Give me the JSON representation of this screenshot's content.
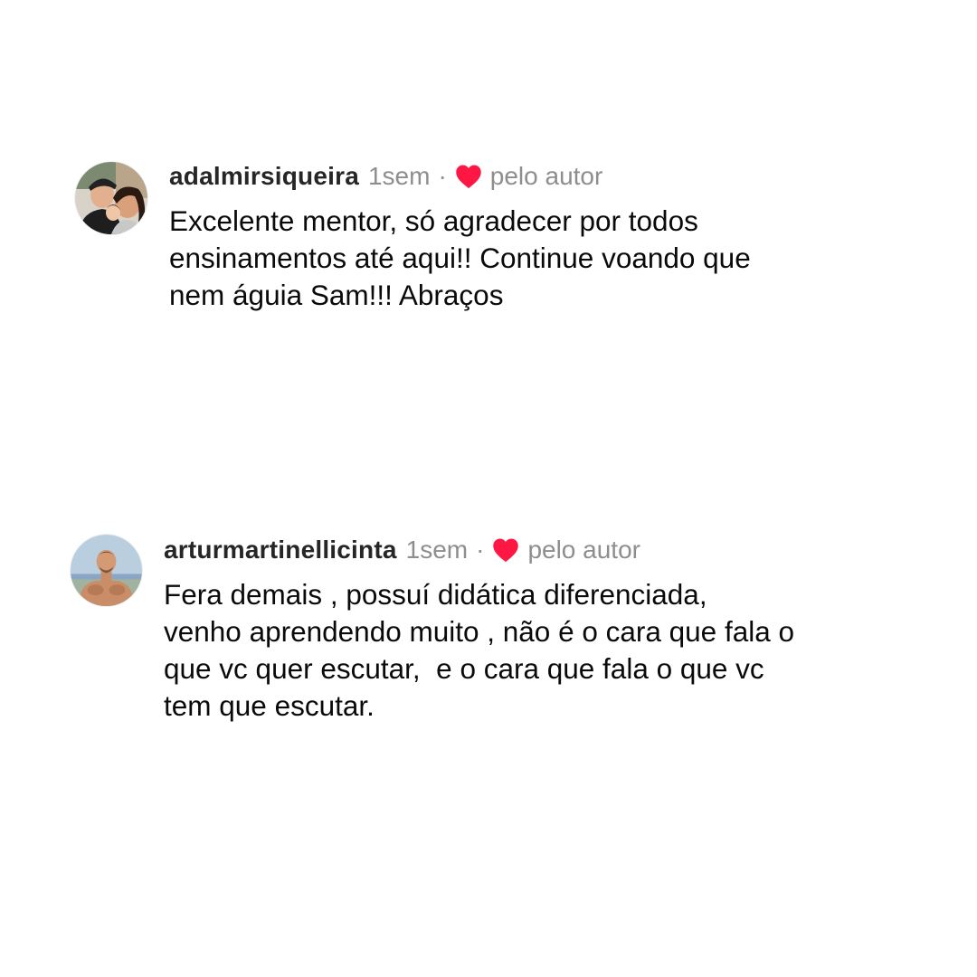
{
  "comments": [
    {
      "username": "adalmirsiqueira",
      "time": "1sem",
      "separator": "·",
      "liked_label": "pelo autor",
      "text": "Excelente mentor, só agradecer por todos\nensinamentos até aqui!! Continue voando que\nnem águia Sam!!! Abraços"
    },
    {
      "username": "arturmartinellicinta",
      "time": "1sem",
      "separator": "·",
      "liked_label": "pelo autor",
      "text": "Fera demais , possuí didática diferenciada,\nvenho aprendendo muito , não é o cara que fala o\nque vc quer escutar,  e o cara que fala o que vc\ntem que escutar."
    }
  ],
  "colors": {
    "heart": "#ff1744",
    "username": "#262626",
    "secondary_text": "#8e8e8e",
    "body_text": "#0a0a0a",
    "background": "#ffffff"
  },
  "icons": {
    "like": "heart-icon",
    "avatar_1": "avatar-photo-couple",
    "avatar_2": "avatar-photo-man-beach"
  }
}
